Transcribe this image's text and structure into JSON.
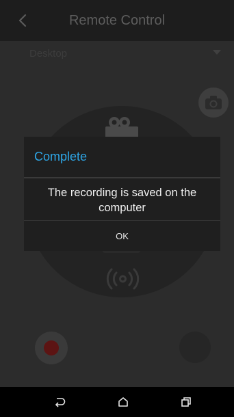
{
  "header": {
    "title": "Remote Control",
    "back_icon": "chevron-left-icon"
  },
  "source": {
    "selected": "Desktop",
    "arrow_icon": "dropdown-triangle-icon"
  },
  "controls": {
    "camera_icon": "camera-icon",
    "video_icon": "video-camera-icon",
    "broadcast_icon": "broadcast-icon",
    "record_icon": "record-icon",
    "stop_icon": "stop-icon"
  },
  "dialog": {
    "title": "Complete",
    "message": "The recording is saved on the computer",
    "ok_label": "OK"
  },
  "navbar": {
    "back_icon": "back-icon",
    "home_icon": "home-icon",
    "recents_icon": "recents-icon"
  },
  "colors": {
    "accent": "#2ea6e6",
    "record": "#5c1413",
    "background": "#2c2c2c",
    "dialog": "#1f1f1f"
  }
}
